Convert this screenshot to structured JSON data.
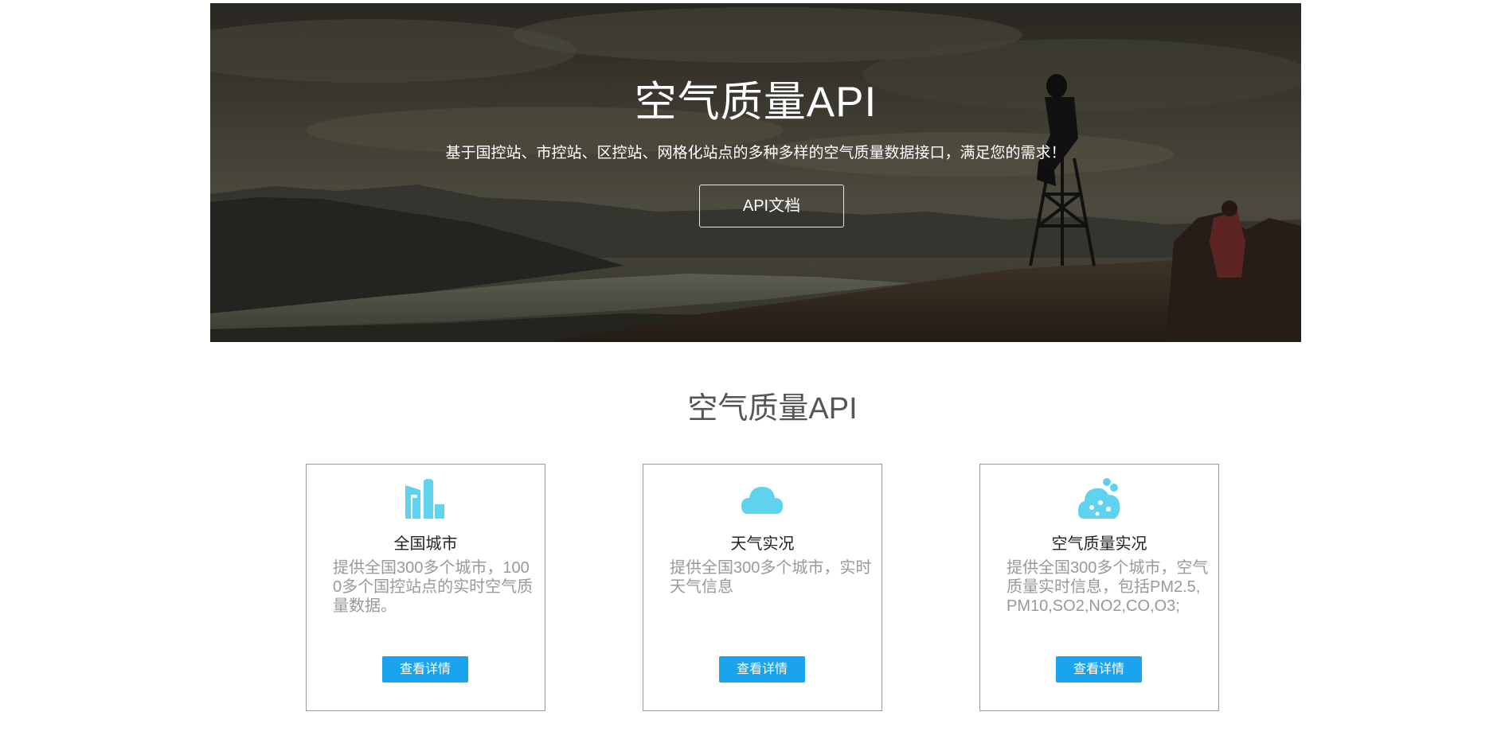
{
  "hero": {
    "title": "空气质量API",
    "subtitle": "基于国控站、市控站、区控站、网格化站点的多种多样的空气质量数据接口，满足您的需求！",
    "button_label": "API文档"
  },
  "section": {
    "title": "空气质量API"
  },
  "cards": [
    {
      "icon": "city-buildings-icon",
      "title": "全国城市",
      "description": "提供全国300多个城市，1000多个国控站点的实时空气质量数据。",
      "button_label": "查看详情"
    },
    {
      "icon": "cloud-icon",
      "title": "天气实况",
      "description": "提供全国300多个城市，实时天气信息",
      "button_label": "查看详情"
    },
    {
      "icon": "pollution-cloud-icon",
      "title": "空气质量实况",
      "description": "提供全国300多个城市，空气质量实时信息，包括PM2.5,PM10,SO2,NO2,CO,O3;",
      "button_label": "查看详情"
    }
  ],
  "colors": {
    "accent": "#1aa4ee",
    "icon": "#5fd3ee",
    "card_border": "#999999",
    "description": "#999999"
  }
}
